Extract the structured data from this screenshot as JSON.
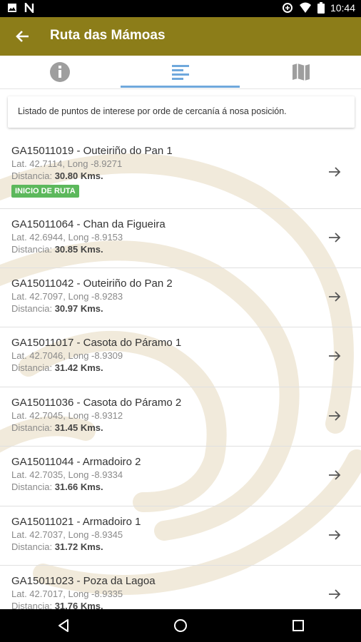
{
  "status_bar": {
    "time": "10:44",
    "left_icons": [
      "image-icon",
      "n-notification-icon"
    ],
    "right_icons": [
      "data-saver-icon",
      "wifi-icon",
      "battery-icon"
    ]
  },
  "app_bar": {
    "title": "Ruta das Mámoas",
    "back_icon": "arrow-back-icon",
    "color": "#8c7d19"
  },
  "tabs": [
    {
      "icon": "info-icon",
      "selected": false
    },
    {
      "icon": "list-icon",
      "selected": true
    },
    {
      "icon": "map-icon",
      "selected": false
    }
  ],
  "info_card": {
    "text": "Listado de puntos de interese por orde de cercanía á nosa posición."
  },
  "points": [
    {
      "title": "GA15011019 - Outeiriño do Pan 1",
      "coords": "Lat. 42.7114, Long -8.9271",
      "dist_label": "Distancia: ",
      "dist_value": "30.80 Kms.",
      "badge": "INICIO DE RUTA"
    },
    {
      "title": "GA15011064 - Chan da Figueira",
      "coords": "Lat. 42.6944, Long -8.9153",
      "dist_label": "Distancia: ",
      "dist_value": "30.85 Kms."
    },
    {
      "title": "GA15011042 - Outeiriño do Pan 2",
      "coords": "Lat. 42.7097, Long -8.9283",
      "dist_label": "Distancia: ",
      "dist_value": "30.97 Kms."
    },
    {
      "title": "GA15011017 - Casota do Páramo 1",
      "coords": "Lat. 42.7046, Long -8.9309",
      "dist_label": "Distancia: ",
      "dist_value": "31.42 Kms."
    },
    {
      "title": "GA15011036 - Casota do Páramo 2",
      "coords": "Lat. 42.7045, Long -8.9312",
      "dist_label": "Distancia: ",
      "dist_value": "31.45 Kms."
    },
    {
      "title": "GA15011044 - Armadoiro 2",
      "coords": "Lat. 42.7035, Long -8.9334",
      "dist_label": "Distancia: ",
      "dist_value": "31.66 Kms."
    },
    {
      "title": "GA15011021 - Armadoiro 1",
      "coords": "Lat. 42.7037, Long -8.9345",
      "dist_label": "Distancia: ",
      "dist_value": "31.72 Kms."
    },
    {
      "title": "GA15011023 - Poza da Lagoa",
      "coords": "Lat. 42.7017, Long -8.9335",
      "dist_label": "Distancia: ",
      "dist_value": "31.76 Kms."
    }
  ],
  "nav_bar": {
    "buttons": [
      "back-triangle-icon",
      "home-circle-icon",
      "recents-square-icon"
    ]
  }
}
